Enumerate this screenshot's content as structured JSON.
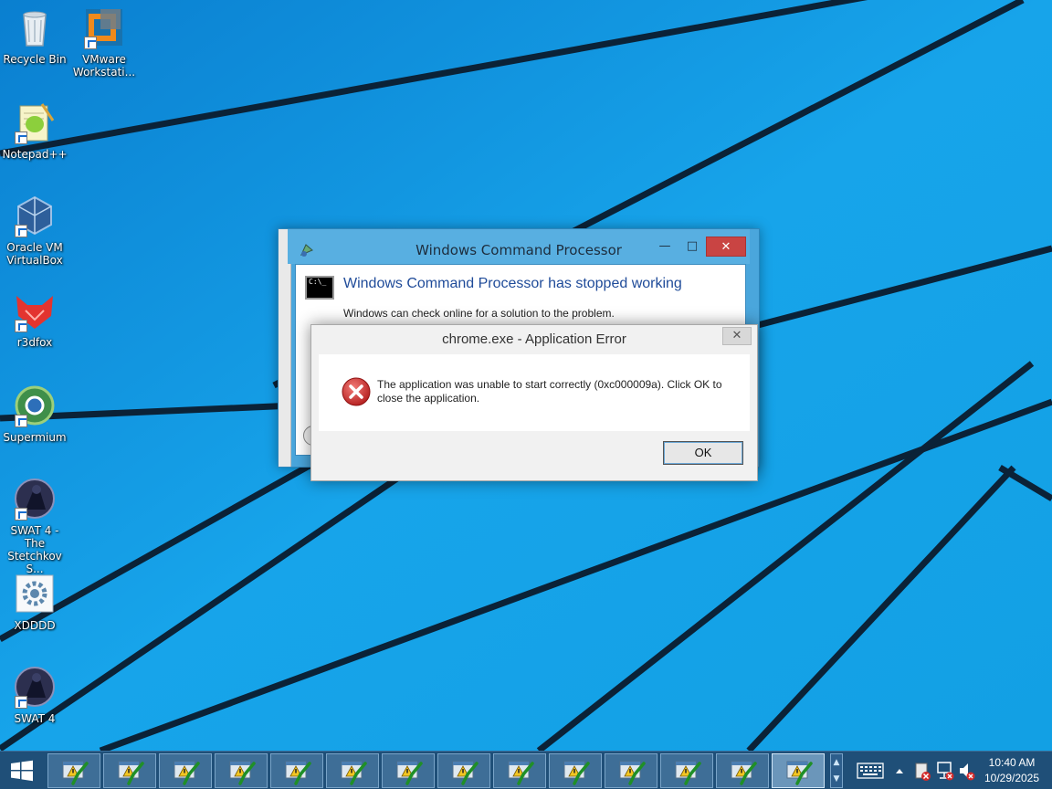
{
  "desktop": {
    "icons": [
      {
        "label": "Recycle Bin",
        "icon": "recycle-bin-icon"
      },
      {
        "label": "VMware Workstati...",
        "icon": "vmware-icon"
      },
      {
        "label": "Notepad++",
        "icon": "notepad-plus-plus-icon"
      },
      {
        "label": "Oracle VM VirtualBox",
        "icon": "virtualbox-icon"
      },
      {
        "label": "r3dfox",
        "icon": "r3dfox-icon"
      },
      {
        "label": "Supermium",
        "icon": "supermium-icon"
      },
      {
        "label": "SWAT 4 - The Stetchkov S...",
        "icon": "swat4-icon"
      },
      {
        "label": "XDDDD",
        "icon": "settings-gear-icon"
      },
      {
        "label": "SWAT 4",
        "icon": "swat4-icon"
      }
    ]
  },
  "wcp_dialog": {
    "title": "Windows Command Processor",
    "headline": "Windows Command Processor has stopped working",
    "subtext": "Windows can check online for a solution to the problem.",
    "cmd_icon_text": "C:\\_",
    "minimize": "—",
    "maximize": "□",
    "close": "✕"
  },
  "app_error_dialog": {
    "title": "chrome.exe - Application Error",
    "message": "The application was unable to start correctly (0xc000009a). Click OK to close the application.",
    "ok_label": "OK",
    "close": "✕"
  },
  "taskbar": {
    "item_count": 14,
    "active_index": 13,
    "time": "10:40 AM",
    "date": "10/29/2025"
  },
  "colors": {
    "wallpaper": "#1aa3e6",
    "taskbar": "#1f4f78",
    "close_red": "#c94443",
    "headline_blue": "#1f4b99"
  }
}
